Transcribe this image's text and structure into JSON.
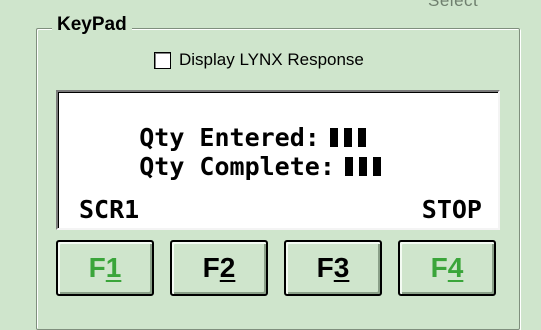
{
  "top_fragment": "Select",
  "keypad": {
    "title": "KeyPad",
    "display_checkbox_label": "Display LYNX Response",
    "display_checkbox_checked": false
  },
  "display": {
    "line1": "Qty Entered:",
    "line2": "Qty Complete:",
    "status_left": "SCR1",
    "status_right": "STOP"
  },
  "fkeys": [
    {
      "prefix": "F",
      "num": "1",
      "color": "#3aa53a"
    },
    {
      "prefix": "F",
      "num": "2",
      "color": "#000000"
    },
    {
      "prefix": "F",
      "num": "3",
      "color": "#000000"
    },
    {
      "prefix": "F",
      "num": "4",
      "color": "#3aa53a"
    }
  ]
}
